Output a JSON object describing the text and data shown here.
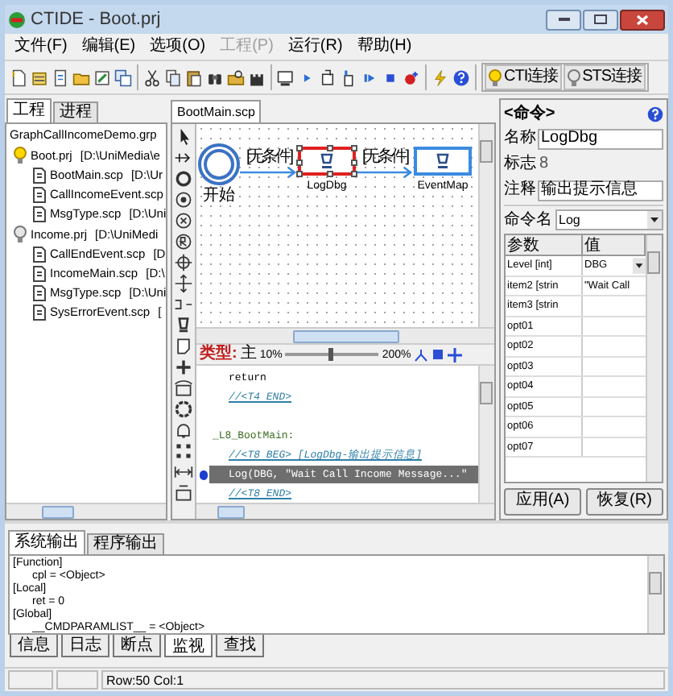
{
  "window": {
    "title": "CTIDE - Boot.prj"
  },
  "menu": [
    {
      "label": "文件(F)",
      "disabled": false
    },
    {
      "label": "编辑(E)",
      "disabled": false
    },
    {
      "label": "选项(O)",
      "disabled": false
    },
    {
      "label": "工程(P)",
      "disabled": true
    },
    {
      "label": "运行(R)",
      "disabled": false
    },
    {
      "label": "帮助(H)",
      "disabled": false
    }
  ],
  "toolbar": {
    "connections": [
      {
        "label": "CTI连接",
        "connected": true
      },
      {
        "label": "STS连接",
        "connected": false
      }
    ]
  },
  "left_panel": {
    "tabs": [
      {
        "label": "工程",
        "selected": true
      },
      {
        "label": "进程",
        "selected": false
      }
    ],
    "tree": {
      "label": "GraphCallIncomeDemo.grp",
      "children": [
        {
          "label": "Boot.prj",
          "path": "[D:\\UniMedia\\e",
          "active": true,
          "children": [
            {
              "label": "BootMain.scp",
              "path": "[D:\\Ur"
            },
            {
              "label": "CallIncomeEvent.scp"
            },
            {
              "label": "MsgType.scp",
              "path": "[D:\\Uni"
            }
          ]
        },
        {
          "label": "Income.prj",
          "path": "[D:\\UniMedi",
          "active": false,
          "children": [
            {
              "label": "CallEndEvent.scp",
              "path": "[D"
            },
            {
              "label": "IncomeMain.scp",
              "path": "[D:\\"
            },
            {
              "label": "MsgType.scp",
              "path": "[D:\\Uni"
            },
            {
              "label": "SysErrorEvent.scp",
              "path": "["
            }
          ]
        }
      ]
    }
  },
  "editor": {
    "tabs": [
      {
        "label": "BootMain.scp",
        "selected": true
      }
    ],
    "flow": {
      "nodes": [
        {
          "kind": "start",
          "label": "开始",
          "selected": false
        },
        {
          "kind": "command",
          "label": "LogDbg",
          "selected": true
        },
        {
          "kind": "command",
          "label": "EventMap",
          "selected": false
        }
      ],
      "edges": [
        "[无条件]",
        "[无条件]"
      ]
    },
    "code_toolbar": {
      "type_label": "类型:",
      "type_value": "主",
      "zoom_min": "10%",
      "zoom_max": "200%",
      "level": 0.47
    },
    "code": [
      {
        "kind": "code",
        "text": "return",
        "breakpoint": false,
        "highlighted": false
      },
      {
        "kind": "comment",
        "text": "//<T4 END>",
        "breakpoint": false,
        "highlighted": false
      },
      {
        "kind": "blank",
        "breakpoint": false,
        "highlighted": false
      },
      {
        "kind": "label",
        "text": "_L8_BootMain:",
        "breakpoint": false,
        "highlighted": false
      },
      {
        "kind": "comment",
        "text": "//<T8 BEG> [LogDbg-输出提示信息]",
        "breakpoint": false,
        "highlighted": false
      },
      {
        "kind": "code",
        "text": "Log(DBG, \"Wait Call Income Message...\"",
        "breakpoint": true,
        "highlighted": true
      },
      {
        "kind": "comment",
        "text": "//<T8 END>",
        "breakpoint": false,
        "highlighted": false
      }
    ]
  },
  "properties": {
    "title": "<命令>",
    "fields": [
      {
        "label": "名称",
        "value": "LogDbg",
        "readonly": false
      },
      {
        "label": "标志",
        "value": "8",
        "readonly": true
      },
      {
        "label": "注释",
        "value": "输出提示信息",
        "readonly": false
      }
    ],
    "command": {
      "label": "命令名",
      "value": "Log"
    },
    "table": {
      "columns": [
        "参数",
        "值"
      ],
      "rows": [
        {
          "param": "Level [int]",
          "value": "DBG",
          "kind": "dropdown"
        },
        {
          "param": "item2 [strin",
          "value": "\"Wait Call",
          "kind": "text"
        },
        {
          "param": "item3 [strin",
          "kind": "text"
        },
        {
          "param": "opt01",
          "kind": "text"
        },
        {
          "param": "opt02",
          "kind": "text"
        },
        {
          "param": "opt03",
          "kind": "text"
        },
        {
          "param": "opt04",
          "kind": "text"
        },
        {
          "param": "opt05",
          "kind": "text"
        },
        {
          "param": "opt06",
          "kind": "text"
        },
        {
          "param": "opt07",
          "kind": "text"
        }
      ]
    },
    "buttons": [
      "应用(A)",
      "恢复(R)"
    ]
  },
  "output": {
    "tabs": [
      {
        "label": "系统输出",
        "selected": true
      },
      {
        "label": "程序输出",
        "selected": false
      }
    ],
    "lines": [
      {
        "kind": "section",
        "text": "[Function]"
      },
      {
        "kind": "entry",
        "text": "cpl = <Object>"
      },
      {
        "kind": "section",
        "text": "[Local]"
      },
      {
        "kind": "entry",
        "text": "ret = 0"
      },
      {
        "kind": "section",
        "text": "[Global]"
      },
      {
        "kind": "entry",
        "text": "__CMDPARAMLIST__ = <Object>"
      }
    ],
    "bottom_tabs": [
      {
        "label": "信息",
        "selected": false
      },
      {
        "label": "日志",
        "selected": false
      },
      {
        "label": "断点",
        "selected": false
      },
      {
        "label": "监视",
        "selected": true
      },
      {
        "label": "查找",
        "selected": false
      }
    ]
  },
  "status_bar": {
    "position": "Row:50 Col:1"
  }
}
